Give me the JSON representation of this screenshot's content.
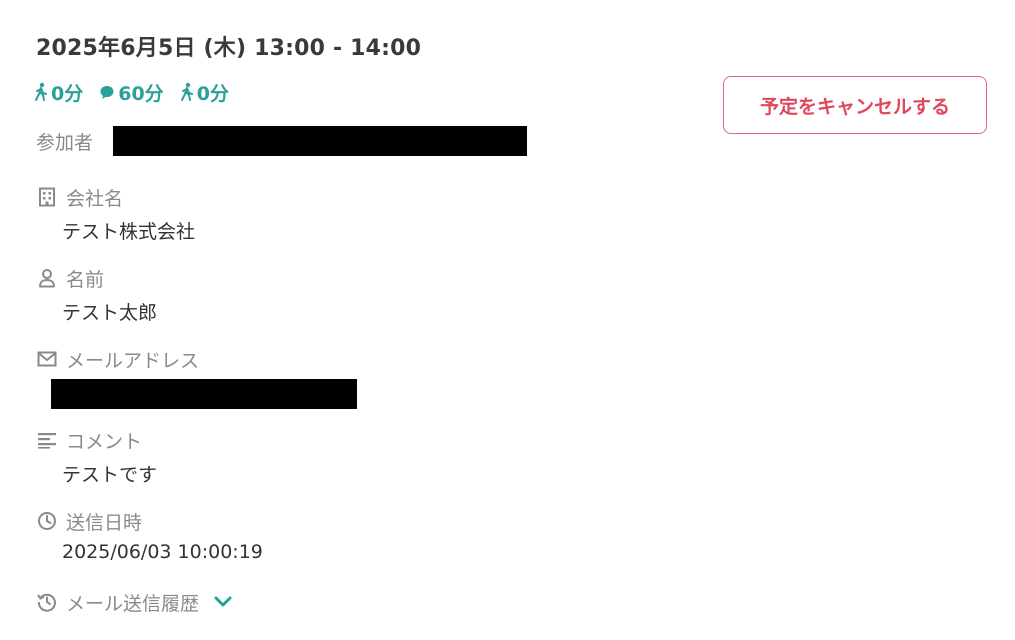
{
  "schedule": {
    "datetime": "2025年6月5日 (木) 13:00 - 14:00",
    "durations": [
      {
        "icon": "walking-icon",
        "value": "0分"
      },
      {
        "icon": "chat-bubble-icon",
        "value": "60分"
      },
      {
        "icon": "walking-icon",
        "value": "0分"
      }
    ],
    "cancel_label": "予定をキャンセルする"
  },
  "participants_label": "参加者",
  "fields": {
    "company": {
      "label": "会社名",
      "icon": "building-icon",
      "value": "テスト株式会社"
    },
    "name": {
      "label": "名前",
      "icon": "person-icon",
      "value": "テスト太郎"
    },
    "email": {
      "label": "メールアドレス",
      "icon": "mail-icon"
    },
    "comment": {
      "label": "コメント",
      "icon": "text-lines-icon",
      "value": "テストです"
    },
    "sent_at": {
      "label": "送信日時",
      "icon": "clock-icon",
      "value": "2025/06/03 10:00:19"
    },
    "mail_history": {
      "label": "メール送信履歴",
      "icon": "history-icon"
    }
  },
  "colors": {
    "accent": "#2aa198",
    "danger": "#e0465c",
    "label": "#8a8a8a"
  }
}
